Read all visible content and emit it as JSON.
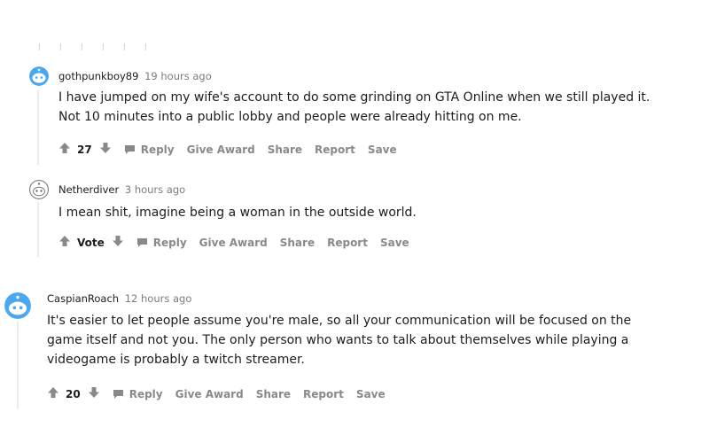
{
  "comments": [
    {
      "author": "gothpunkboy89",
      "time": "19 hours ago",
      "lines": [
        "I have jumped on my wife's account to do some grinding on GTA Online when we still played it.",
        "Not 10 minutes into a public lobby and people were already hitting on me."
      ],
      "votes": "27",
      "actions": {
        "reply": "Reply",
        "award": "Give Award",
        "share": "Share",
        "report": "Report",
        "save": "Save"
      },
      "avatar_color": "#4aa8f0"
    },
    {
      "author": "Netherdiver",
      "time": "3 hours ago",
      "lines": [
        "I mean shit, imagine being a woman in the outside world."
      ],
      "votes": "Vote",
      "actions": {
        "reply": "Reply",
        "award": "Give Award",
        "share": "Share",
        "report": "Report",
        "save": "Save"
      },
      "avatar_color": "#9a9a9a"
    },
    {
      "author": "CaspianRoach",
      "time": "12 hours ago",
      "lines": [
        "It's easier to let people assume you're male, so all your communication will be focused on the",
        "game itself and not you. The only person who wants to talk about themselves while playing a",
        "videogame is probably a twitch streamer."
      ],
      "votes": "20",
      "actions": {
        "reply": "Reply",
        "award": "Give Award",
        "share": "Share",
        "report": "Report",
        "save": "Save"
      },
      "avatar_color": "#4aa8f0"
    }
  ],
  "icons": {
    "upvote": "arrow-up-icon",
    "downvote": "arrow-down-icon",
    "reply": "speech-bubble-icon",
    "avatar": "snoo-avatar-icon"
  }
}
